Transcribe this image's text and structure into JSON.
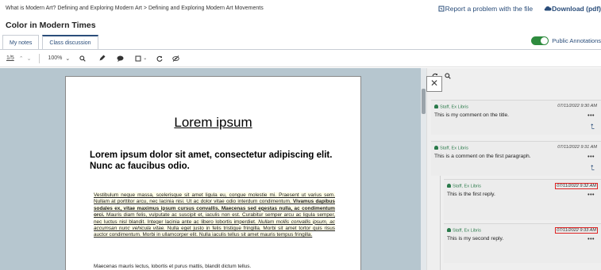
{
  "breadcrumb": "What is Modern Art? Defining and Exploring Modern Art > Defining and Exploring Modern Art Movements",
  "header_actions": {
    "report": "Report a problem with the file",
    "download": "Download (pdf)"
  },
  "page_title": "Color in Modern Times",
  "tabs": [
    "My notes",
    "Class discussion"
  ],
  "public_toggle": {
    "label": "Public Annotations",
    "on": true
  },
  "toolbar": {
    "page": "1/5",
    "zoom": "100%"
  },
  "document": {
    "heading": "Lorem ipsum",
    "subheading": "Lorem ipsum dolor sit amet, consectetur adipiscing elit. Nunc ac faucibus odio.",
    "para1_a": "Vestibulum neque massa, scelerisque sit amet ligula eu, congue molestie mi. Praesent ut varius sem. Nullam at porttitor arcu, nec lacinia nisi. Ut ac dolor vitae odio interdum condimentum. ",
    "para1_b": "Vivamus dapibus sodales ex, vitae maximus ipsum cursus convallis. Maecenas sed egestas nulla, ac condimentum orci.",
    "para1_c": " Mauris diam felis, vulputate ac suscipit et, iaculis non est. Curabitur semper arcu ac ligula semper, nec luctus nisl blandit. Integer lacinia ante ac libero lobortis imperdiet. ",
    "para1_d": "Nullam mollis convallis ipsum, ac accumsan nunc vehicula vitae.",
    "para1_e": " Nulla eget justo in felis tristique fringilla. Morbi sit amet tortor quis risus auctor condimentum. Morbi in ullamcorper elit. Nulla iaculis tellus sit amet mauris tempus fringilla.",
    "para2": "Maecenas mauris lectus, lobortis et purus mattis, blandit dictum tellus."
  },
  "comments": [
    {
      "author": "Staff, Ex Libris",
      "time": "07/11/2022 9:30 AM",
      "text": "This is my comment on the title."
    },
    {
      "author": "Staff, Ex Libris",
      "time": "07/11/2022 9:31 AM",
      "text": "This is a comment on the first paragraph."
    },
    {
      "author": "Staff, Ex Libris",
      "time": "07/11/2022 9:32 AM",
      "text": "This is the first reply."
    },
    {
      "author": "Staff, Ex Libris",
      "time": "07/11/2022 9:33 AM",
      "text": "This is my second reply."
    }
  ]
}
